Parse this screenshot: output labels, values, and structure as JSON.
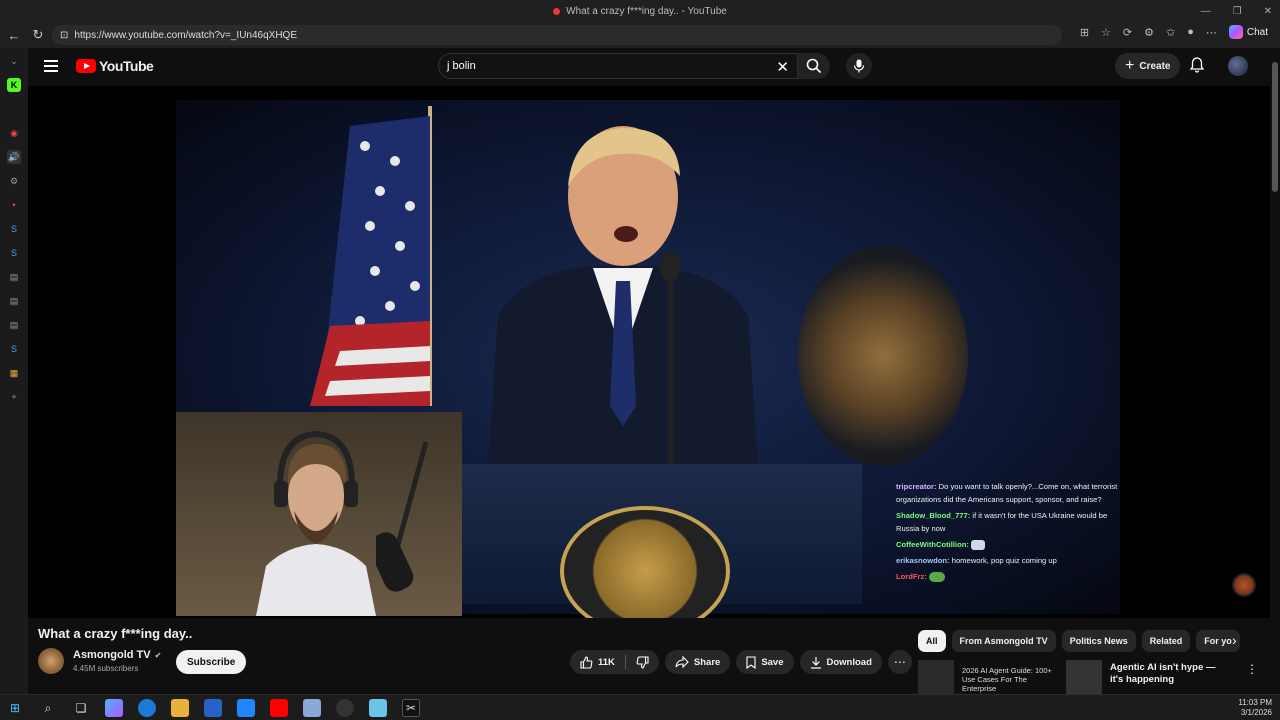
{
  "browser": {
    "tab_title": "What a crazy f***ing day.. - YouTube",
    "url": "https://www.youtube.com/watch?v=_IUn46qXHQE",
    "chat_label": "Chat"
  },
  "youtube": {
    "logo_text": "YouTube",
    "search_value": "j bolin",
    "create_label": "Create"
  },
  "video": {
    "title": "What a crazy f***ing day..",
    "channel": "Asmongold TV",
    "subscribers": "4.45M subscribers",
    "subscribe_label": "Subscribe",
    "like_count": "11K",
    "share_label": "Share",
    "save_label": "Save",
    "download_label": "Download"
  },
  "chat_overlay": [
    {
      "user": "tripcreator:",
      "text": "Do you want to talk openly?...Come on, what terrorist organizations did the Americans support, sponsor, and raise?",
      "color": "#e0b0ff"
    },
    {
      "user": "Shadow_Blood_777:",
      "text": "if it wasn't for the USA Ukraine would be Russia by now",
      "color": "#7cfc7c"
    },
    {
      "user": "CoffeeWithCotillion:",
      "text": "",
      "color": "#7cfc7c"
    },
    {
      "user": "erikasnowdon:",
      "text": "homework, pop quiz coming up",
      "color": "#9fc8ff"
    },
    {
      "user": "LordFrz:",
      "text": "",
      "color": "#ff5555"
    }
  ],
  "chips": [
    "All",
    "From Asmongold TV",
    "Politics News",
    "Related",
    "For yo"
  ],
  "recommendations": {
    "first_title": "2026 AI Agent Guide: 100+ Use Cases For The Enterprise",
    "second_title": "Agentic AI isn't hype — it's happening"
  },
  "taskbar": {
    "time": "11:03 PM",
    "date": "3/1/2026"
  },
  "colors": {
    "accent_red": "#ff0000",
    "background": "#0f0f0f"
  }
}
